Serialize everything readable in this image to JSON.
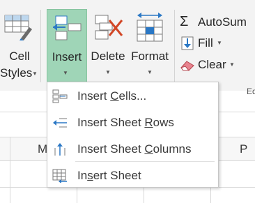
{
  "ribbon": {
    "cell_styles": {
      "line1": "Cell",
      "line2": "Styles"
    },
    "insert": {
      "label": "Insert"
    },
    "delete": {
      "label": "Delete"
    },
    "format": {
      "label": "Format"
    },
    "autosum": {
      "label": "AutoSum"
    },
    "fill": {
      "label": "Fill"
    },
    "clear": {
      "label": "Clear"
    },
    "group_edge_label": "Ed"
  },
  "insert_menu": {
    "items": [
      {
        "pre": "Insert ",
        "accel": "C",
        "post": "ells..."
      },
      {
        "pre": "Insert Sheet ",
        "accel": "R",
        "post": "ows"
      },
      {
        "pre": "Insert Sheet ",
        "accel": "C",
        "post": "olumns"
      },
      {
        "pre": "In",
        "accel": "s",
        "post": "ert Sheet"
      }
    ]
  },
  "sheet": {
    "column_letters": [
      "M",
      "P"
    ]
  },
  "colors": {
    "insert_highlight": "#9fd5b7",
    "delete_x_red": "#d24726",
    "icon_blue": "#2b78c5"
  }
}
